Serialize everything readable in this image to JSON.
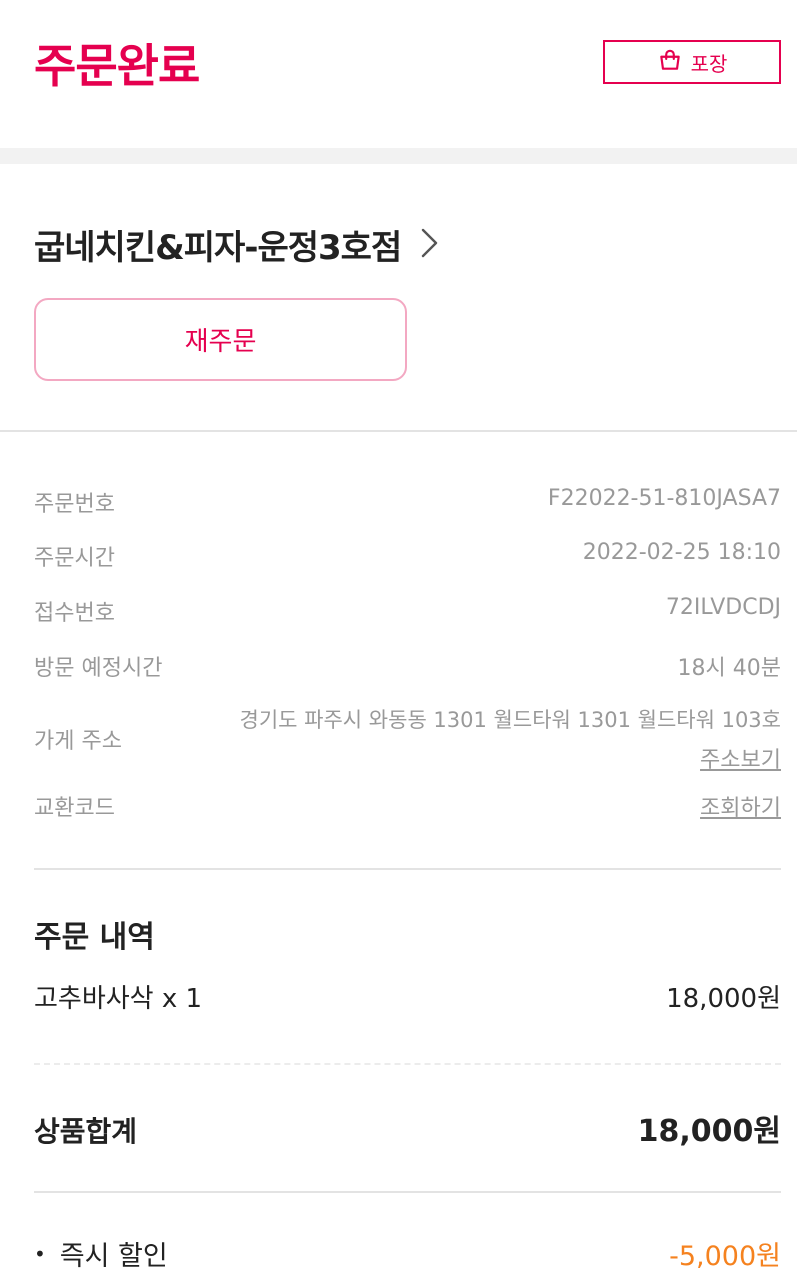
{
  "header": {
    "title": "주문완료",
    "badge_label": "포장"
  },
  "store": {
    "name": "굽네치킨&피자-운정3호점",
    "reorder_label": "재주문"
  },
  "info": {
    "order_number_label": "주문번호",
    "order_number": "F22022-51-810JASA7",
    "order_time_label": "주문시간",
    "order_time": "2022-02-25 18:10",
    "receipt_number_label": "접수번호",
    "receipt_number": "72ILVDCDJ",
    "visit_time_label": "방문 예정시간",
    "visit_time": "18시 40분",
    "address_label": "가게 주소",
    "address": "경기도 파주시 와동동 1301 월드타워 1301 월드타워 103호",
    "address_link": "주소보기",
    "exchange_code_label": "교환코드",
    "exchange_code_link": "조회하기"
  },
  "order": {
    "section_title": "주문 내역",
    "items": [
      {
        "name": "고추바사삭 x 1",
        "price": "18,000원"
      }
    ],
    "subtotal_label": "상품합계",
    "subtotal": "18,000원",
    "discount_label": "즉시 할인",
    "discount": "-5,000원",
    "bullet": "•"
  },
  "colors": {
    "accent": "#e5004f",
    "discount": "#f5821f"
  }
}
